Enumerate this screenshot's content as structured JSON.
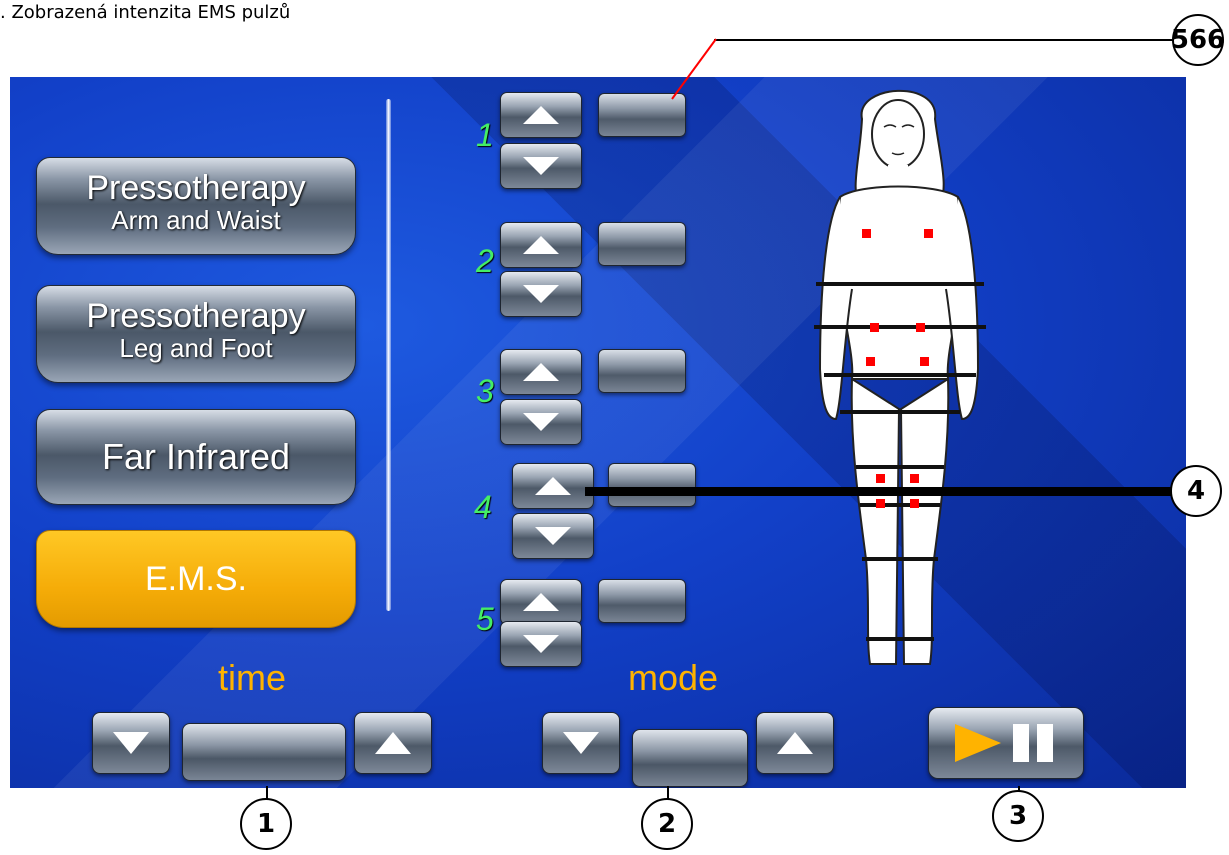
{
  "caption": ". Zobrazená intenzita EMS pulzů",
  "callouts": {
    "top_right": "566",
    "c1": "1",
    "c2": "2",
    "c3": "3",
    "c4": "4"
  },
  "modes": [
    {
      "line1": "Pressotherapy",
      "line2": "Arm and Waist"
    },
    {
      "line1": "Pressotherapy",
      "line2": "Leg and Foot"
    },
    {
      "label": "Far Infrared"
    },
    {
      "label": "E.M.S.",
      "active": true
    }
  ],
  "channels": [
    "1",
    "2",
    "3",
    "4",
    "5"
  ],
  "bottom": {
    "time_label": "time",
    "mode_label": "mode"
  },
  "colors": {
    "active_mode": "#f5ac08",
    "channel_number": "#44ee66",
    "bottom_label": "#ffb300",
    "electrode": "#ff0000",
    "play_icon": "#ffb300"
  },
  "icons": {
    "up": "triangle-up-icon",
    "down": "triangle-down-icon",
    "play_pause": "play-pause-icon"
  }
}
